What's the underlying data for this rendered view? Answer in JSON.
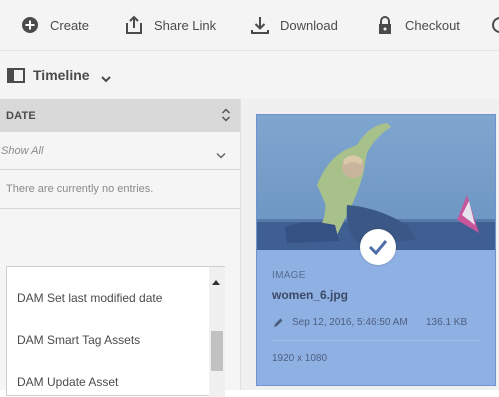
{
  "toolbar": {
    "create": "Create",
    "share_link": "Share Link",
    "download": "Download",
    "checkout": "Checkout"
  },
  "rail": {
    "title": "Timeline"
  },
  "filters": {
    "header": "DATE",
    "show_all": "Show All",
    "empty_text": "There are currently no entries."
  },
  "workflow_list": {
    "items": [
      "DAM Set last modified date",
      "DAM Smart Tag Assets",
      "DAM Update Asset"
    ]
  },
  "asset": {
    "type": "IMAGE",
    "name": "women_6.jpg",
    "modified": "Sep 12, 2016, 5:46:50 AM",
    "size": "136.1 KB",
    "dimensions": "1920 x 1080",
    "selected": true
  },
  "colors": {
    "selection_overlay": "#8fb0e3",
    "toolbar_bg": "#f4f4f4",
    "text": "#4b4b4b"
  },
  "icons": [
    "add-circle-icon",
    "share-icon",
    "download-icon",
    "lock-icon",
    "rail-panel-icon",
    "chevron-down-icon",
    "sort-icon",
    "checkmark-icon",
    "pencil-icon"
  ]
}
